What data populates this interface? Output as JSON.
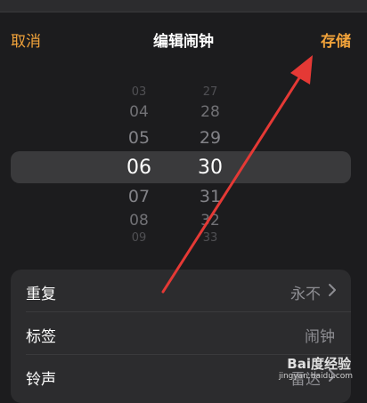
{
  "nav": {
    "cancel_label": "取消",
    "title": "编辑闹钟",
    "save_label": "存储"
  },
  "picker": {
    "hours": [
      "03",
      "04",
      "05",
      "06",
      "07",
      "08",
      "09"
    ],
    "minutes": [
      "27",
      "28",
      "29",
      "30",
      "31",
      "32",
      "33"
    ],
    "selected_hour": "06",
    "selected_minute": "30"
  },
  "settings": [
    {
      "label": "重复",
      "value": "永不",
      "has_chevron": true
    },
    {
      "label": "标签",
      "value": "闹钟",
      "has_chevron": false
    },
    {
      "label": "铃声",
      "value": "雷达",
      "has_chevron": true
    }
  ],
  "watermark": {
    "brand": "Bai度经验",
    "url": "jingyan.baidu.com"
  },
  "colors": {
    "accent": "#f2a33a",
    "background": "#1c1c1e",
    "annotation_arrow": "#e53935"
  }
}
